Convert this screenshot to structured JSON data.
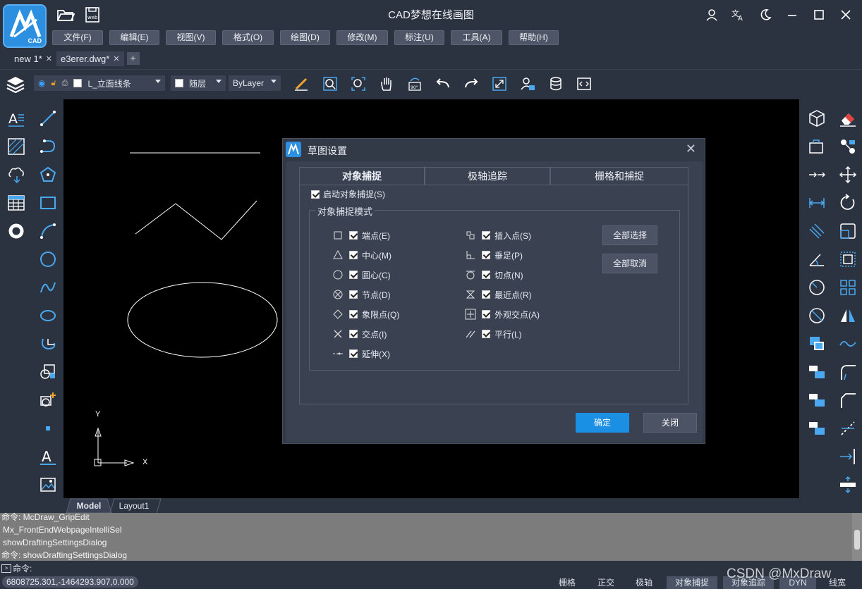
{
  "app": {
    "title": "CAD梦想在线画图",
    "logo_text": "CAD"
  },
  "menu": [
    "文件(F)",
    "编辑(E)",
    "视图(V)",
    "格式(O)",
    "绘图(D)",
    "修改(M)",
    "标注(U)",
    "工具(A)",
    "帮助(H)"
  ],
  "doc_tabs": [
    {
      "label": "new 1*",
      "active": false
    },
    {
      "label": "e3erer.dwg*",
      "active": true
    }
  ],
  "toolbar": {
    "layer": "L_立面线条",
    "color": "随层",
    "linetype": "ByLayer"
  },
  "layout_tabs": [
    "Model",
    "Layout1"
  ],
  "command_history": [
    "命令: McDraw_GripEdit",
    "Mx_FrontEndWebpageIntelliSel",
    "showDraftingSettingsDialog",
    "命令: showDraftingSettingsDialog"
  ],
  "command_prompt": "命令:",
  "coords": "6808725.301,-1464293.907,0.000",
  "status_buttons": [
    {
      "label": "栅格",
      "on": false
    },
    {
      "label": "正交",
      "on": false
    },
    {
      "label": "极轴",
      "on": false
    },
    {
      "label": "对象捕捉",
      "on": true
    },
    {
      "label": "对象追踪",
      "on": true
    },
    {
      "label": "DYN",
      "on": true
    },
    {
      "label": "线宽",
      "on": false
    }
  ],
  "watermark": "CSDN @MxDraw",
  "ucs": {
    "x": "X",
    "y": "Y"
  },
  "dialog": {
    "title": "草图设置",
    "tabs": [
      "对象捕捉",
      "极轴追踪",
      "栅格和捕捉"
    ],
    "enable_label": "启动对象捕捉(S)",
    "group_title": "对象捕捉模式",
    "snaps_left": [
      "端点(E)",
      "中心(M)",
      "圆心(C)",
      "节点(D)",
      "象限点(Q)",
      "交点(I)",
      "延伸(X)"
    ],
    "snaps_right": [
      "插入点(S)",
      "垂足(P)",
      "切点(N)",
      "最近点(R)",
      "外观交点(A)",
      "平行(L)"
    ],
    "select_all": "全部选择",
    "clear_all": "全部取消",
    "ok": "确定",
    "close": "关闭"
  }
}
